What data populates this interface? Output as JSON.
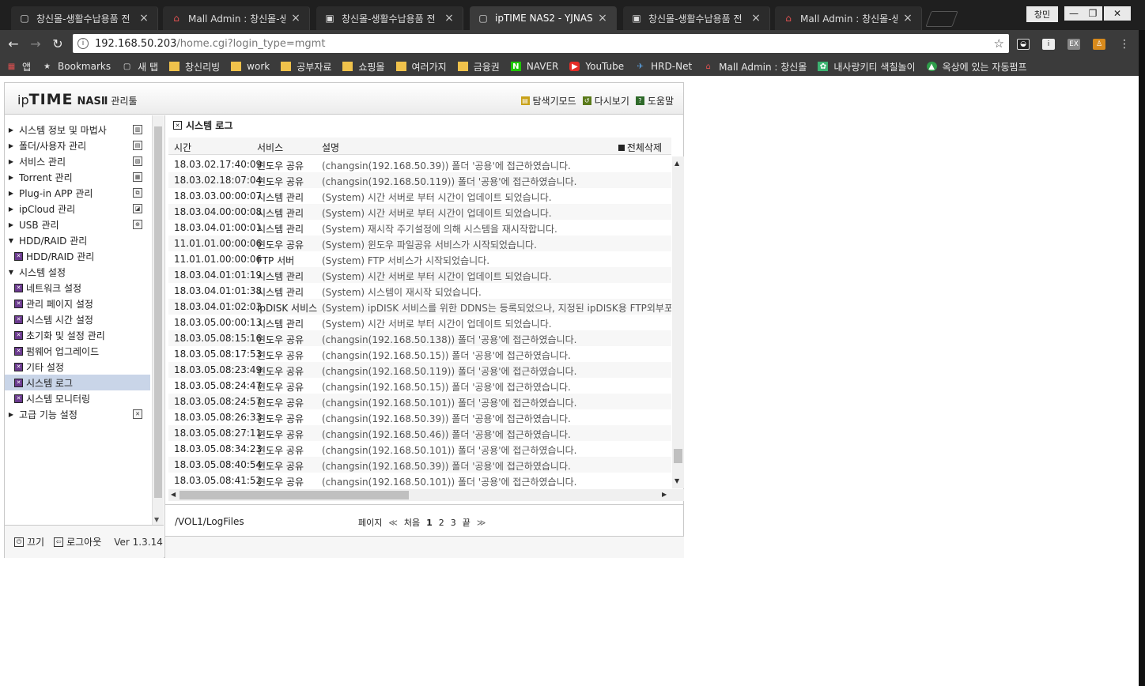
{
  "browser": {
    "tabs": [
      {
        "title": "창신몰-생활수납용품 전",
        "icon": "page-icon",
        "active": false
      },
      {
        "title": "Mall Admin : 창신몰-생",
        "icon": "mall-admin-icon",
        "active": false
      },
      {
        "title": "창신몰-생활수납용품 전",
        "icon": "shop-icon",
        "active": false
      },
      {
        "title": "ipTIME NAS2 - YJNAS2",
        "icon": "page-icon",
        "active": true
      },
      {
        "title": "창신몰-생활수납용품 전",
        "icon": "shop-icon",
        "active": false
      },
      {
        "title": "Mall Admin : 창신몰-생",
        "icon": "mall-admin-icon",
        "active": false
      }
    ],
    "tab_close_glyph": "×",
    "profile_label": "창민",
    "url_host": "192.168.50.203",
    "url_path": "/home.cgi?login_type=mgmt",
    "bookmarks": [
      {
        "label": "앱",
        "icon": "apps-icon"
      },
      {
        "label": "Bookmarks",
        "icon": "star-icon"
      },
      {
        "label": "새 탭",
        "icon": "page-icon"
      },
      {
        "label": "창신리빙",
        "icon": "folder-icon"
      },
      {
        "label": "work",
        "icon": "folder-icon"
      },
      {
        "label": "공부자료",
        "icon": "folder-icon"
      },
      {
        "label": "쇼핑몰",
        "icon": "folder-icon"
      },
      {
        "label": "여러가지",
        "icon": "folder-icon"
      },
      {
        "label": "금융권",
        "icon": "folder-icon"
      },
      {
        "label": "NAVER",
        "icon": "naver-icon"
      },
      {
        "label": "YouTube",
        "icon": "youtube-icon"
      },
      {
        "label": "HRD-Net",
        "icon": "hrd-icon"
      },
      {
        "label": "Mall Admin : 창신몰",
        "icon": "mall-admin-icon"
      },
      {
        "label": "내사랑키티 색칠놀이",
        "icon": "kitty-icon"
      },
      {
        "label": "옥상에 있는 자동펌프",
        "icon": "edu-icon"
      }
    ]
  },
  "app": {
    "logo": {
      "ip": "ip",
      "time": "TIME",
      "nas": "NASⅡ",
      "tool": "관리툴"
    },
    "header_links": [
      {
        "label": "탐색기모드",
        "icon": "explorer-mode-icon",
        "color": "#c9a21a"
      },
      {
        "label": "다시보기",
        "icon": "refresh-icon",
        "color": "#5a7a1a"
      },
      {
        "label": "도움말",
        "icon": "help-icon",
        "color": "#2f6a2a"
      }
    ],
    "menu": [
      {
        "label": "시스템 정보 및 마법사",
        "type": "parent",
        "expanded": false,
        "right_icon": "chart-icon"
      },
      {
        "label": "폴더/사용자 관리",
        "type": "parent",
        "expanded": false,
        "right_icon": "folder-user-icon"
      },
      {
        "label": "서비스 관리",
        "type": "parent",
        "expanded": false,
        "right_icon": "service-icon"
      },
      {
        "label": "Torrent 관리",
        "type": "parent",
        "expanded": false,
        "right_icon": "torrent-icon"
      },
      {
        "label": "Plug-in APP 관리",
        "type": "parent",
        "expanded": false,
        "right_icon": "plugin-icon"
      },
      {
        "label": "ipCloud 관리",
        "type": "parent",
        "expanded": false,
        "right_icon": "cloud-icon"
      },
      {
        "label": "USB 관리",
        "type": "parent",
        "expanded": false,
        "right_icon": "usb-icon"
      },
      {
        "label": "HDD/RAID 관리",
        "type": "parent",
        "expanded": true,
        "right_icon": ""
      },
      {
        "label": "HDD/RAID 관리",
        "type": "sub",
        "selected": false
      },
      {
        "label": "시스템 설정",
        "type": "parent",
        "expanded": true,
        "right_icon": ""
      },
      {
        "label": "네트워크 설정",
        "type": "sub",
        "selected": false
      },
      {
        "label": "관리 페이지 설정",
        "type": "sub",
        "selected": false
      },
      {
        "label": "시스템 시간 설정",
        "type": "sub",
        "selected": false
      },
      {
        "label": "초기화 및 설정 관리",
        "type": "sub",
        "selected": false
      },
      {
        "label": "펌웨어 업그레이드",
        "type": "sub",
        "selected": false
      },
      {
        "label": "기타 설정",
        "type": "sub",
        "selected": false
      },
      {
        "label": "시스템 로그",
        "type": "sub",
        "selected": true
      },
      {
        "label": "시스템 모니터링",
        "type": "sub",
        "selected": false
      },
      {
        "label": "고급 기능 설정",
        "type": "parent",
        "expanded": false,
        "right_icon": "advanced-icon"
      }
    ],
    "footer": {
      "power_label": "끄기",
      "logout_label": "로그아웃",
      "version": "Ver 1.3.14"
    },
    "content": {
      "title": "시스템 로그",
      "columns": {
        "time": "시간",
        "service": "서비스",
        "desc": "설명"
      },
      "delete_all": "전체삭제",
      "rows": [
        {
          "time": "18.03.02.17:40:09",
          "service": "윈도우 공유",
          "desc": "(changsin(192.168.50.39)) 폴더 '공용'에 접근하였습니다."
        },
        {
          "time": "18.03.02.18:07:04",
          "service": "윈도우 공유",
          "desc": "(changsin(192.168.50.119)) 폴더 '공용'에 접근하였습니다."
        },
        {
          "time": "18.03.03.00:00:07",
          "service": "시스템 관리",
          "desc": "(System) 시간 서버로 부터 시간이 업데이트 되었습니다."
        },
        {
          "time": "18.03.04.00:00:08",
          "service": "시스템 관리",
          "desc": "(System) 시간 서버로 부터 시간이 업데이트 되었습니다."
        },
        {
          "time": "18.03.04.01:00:01",
          "service": "시스템 관리",
          "desc": "(System) 재시작 주기설정에 의해 시스템을 재시작합니다."
        },
        {
          "time": "11.01.01.00:00:06",
          "service": "윈도우 공유",
          "desc": "(System) 윈도우 파일공유 서비스가 시작되었습니다."
        },
        {
          "time": "11.01.01.00:00:06",
          "service": "FTP 서버",
          "desc": "(System) FTP 서비스가 시작되었습니다."
        },
        {
          "time": "18.03.04.01:01:19",
          "service": "시스템 관리",
          "desc": "(System) 시간 서버로 부터 시간이 업데이트 되었습니다."
        },
        {
          "time": "18.03.04.01:01:38",
          "service": "시스템 관리",
          "desc": "(System) 시스템이 재시작 되었습니다."
        },
        {
          "time": "18.03.04.01:02:03",
          "service": "ipDISK 서비스",
          "desc": "(System) ipDISK 서비스를 위한 DDNS는 등록되었으나, 지정된 ipDISK용 FTP외부포"
        },
        {
          "time": "18.03.05.00:00:13",
          "service": "시스템 관리",
          "desc": "(System) 시간 서버로 부터 시간이 업데이트 되었습니다."
        },
        {
          "time": "18.03.05.08:15:16",
          "service": "윈도우 공유",
          "desc": "(changsin(192.168.50.138)) 폴더 '공용'에 접근하였습니다."
        },
        {
          "time": "18.03.05.08:17:53",
          "service": "윈도우 공유",
          "desc": "(changsin(192.168.50.15)) 폴더 '공용'에 접근하였습니다."
        },
        {
          "time": "18.03.05.08:23:49",
          "service": "윈도우 공유",
          "desc": "(changsin(192.168.50.119)) 폴더 '공용'에 접근하였습니다."
        },
        {
          "time": "18.03.05.08:24:47",
          "service": "윈도우 공유",
          "desc": "(changsin(192.168.50.15)) 폴더 '공용'에 접근하였습니다."
        },
        {
          "time": "18.03.05.08:24:57",
          "service": "윈도우 공유",
          "desc": "(changsin(192.168.50.101)) 폴더 '공용'에 접근하였습니다."
        },
        {
          "time": "18.03.05.08:26:33",
          "service": "윈도우 공유",
          "desc": "(changsin(192.168.50.39)) 폴더 '공용'에 접근하였습니다."
        },
        {
          "time": "18.03.05.08:27:11",
          "service": "윈도우 공유",
          "desc": "(changsin(192.168.50.46)) 폴더 '공용'에 접근하였습니다."
        },
        {
          "time": "18.03.05.08:34:23",
          "service": "윈도우 공유",
          "desc": "(changsin(192.168.50.101)) 폴더 '공용'에 접근하였습니다."
        },
        {
          "time": "18.03.05.08:40:54",
          "service": "윈도우 공유",
          "desc": "(changsin(192.168.50.39)) 폴더 '공용'에 접근하였습니다."
        },
        {
          "time": "18.03.05.08:41:52",
          "service": "윈도우 공유",
          "desc": "(changsin(192.168.50.101)) 폴더 '공용'에 접근하였습니다."
        }
      ],
      "path": "/VOL1/LogFiles",
      "pager": {
        "label": "페이지",
        "first": "처음",
        "pages": [
          "1",
          "2",
          "3"
        ],
        "current": "1",
        "last": "끝",
        "prev_glyph": "≪",
        "next_glyph": "≫"
      }
    }
  }
}
